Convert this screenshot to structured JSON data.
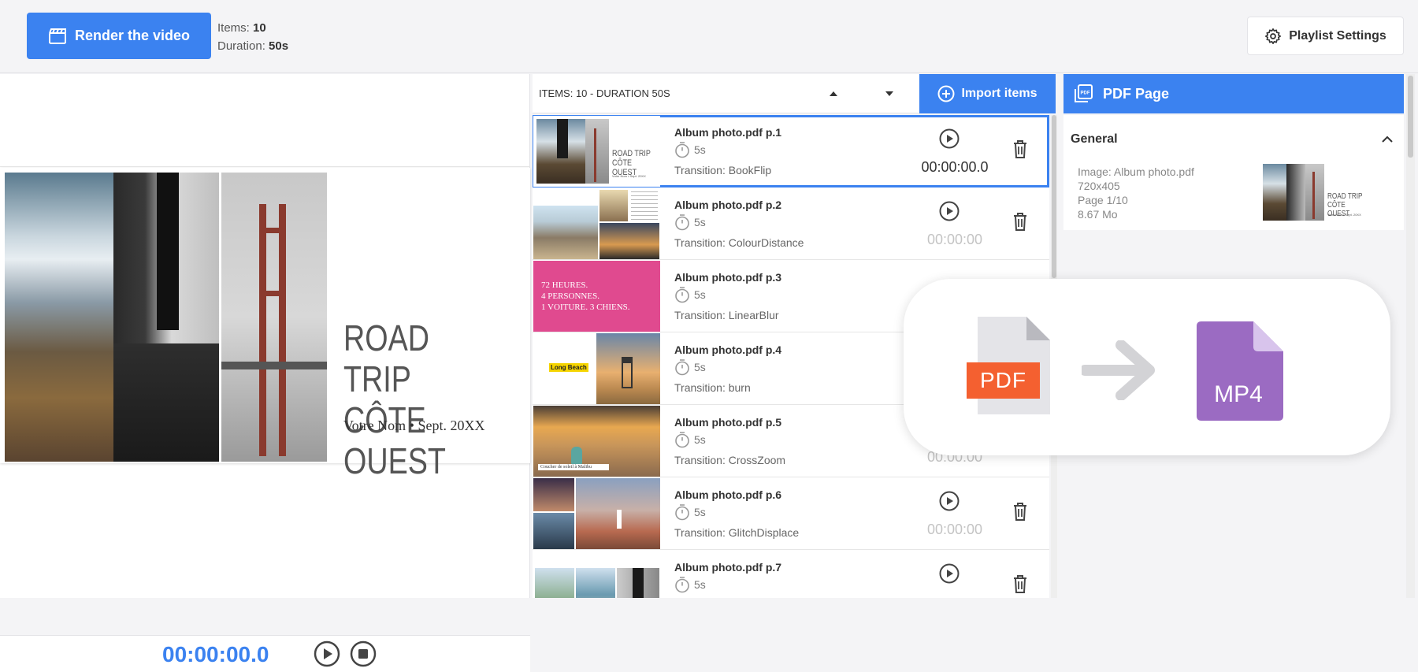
{
  "toolbar": {
    "render_label": "Render the video",
    "items_label": "Items:",
    "items_value": "10",
    "duration_label": "Duration:",
    "duration_value": "50s",
    "settings_label": "Playlist Settings"
  },
  "preview": {
    "slide_title": "ROAD TRIP\nCÔTE OUEST",
    "slide_subtitle": "Votre Nom • Sept. 20XX",
    "time": "00:00:00.0"
  },
  "playlist": {
    "header": "ITEMS: 10 - DURATION 50S",
    "import_label": "Import items",
    "items": [
      {
        "title": "Album photo.pdf p.1",
        "duration": "5s",
        "transition": "Transition: BookFlip",
        "time": "00:00:00.0"
      },
      {
        "title": "Album photo.pdf p.2",
        "duration": "5s",
        "transition": "Transition: ColourDistance",
        "time": "00:00:00"
      },
      {
        "title": "Album photo.pdf p.3",
        "duration": "5s",
        "transition": "Transition: LinearBlur",
        "time": ""
      },
      {
        "title": "Album photo.pdf p.4",
        "duration": "5s",
        "transition": "Transition: burn",
        "time": ""
      },
      {
        "title": "Album photo.pdf p.5",
        "duration": "5s",
        "transition": "Transition: CrossZoom",
        "time": "00:00:00"
      },
      {
        "title": "Album photo.pdf p.6",
        "duration": "5s",
        "transition": "Transition: GlitchDisplace",
        "time": "00:00:00"
      },
      {
        "title": "Album photo.pdf p.7",
        "duration": "5s",
        "transition": "",
        "time": ""
      }
    ],
    "thumb_texts": {
      "p1_title": "ROAD TRIP\nCÔTE OUEST",
      "p1_sub": "Votre Nom • Sept. 20XX",
      "p3_text": "72 HEURES.\n4 PERSONNES.\n1 VOITURE. 3 CHIENS.",
      "p4_text": "Long Beach",
      "p5_caption": "Coucher de soleil à Malibu"
    }
  },
  "panel": {
    "header": "PDF Page",
    "general_title": "General",
    "image": "Image: Album photo.pdf",
    "resolution": "720x405",
    "page": "Page 1/10",
    "size": "8.67 Mo"
  },
  "overlay": {
    "from": "PDF",
    "to": "MP4"
  },
  "colors": {
    "accent": "#3b82f0",
    "pdf_orange": "#f46030",
    "mp4_purple": "#9b6bc2",
    "magenta_slide": "#e04a8f"
  }
}
